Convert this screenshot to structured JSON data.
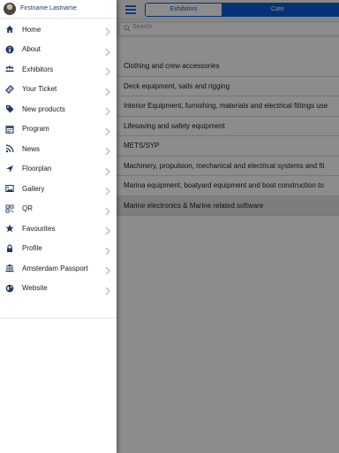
{
  "profile": {
    "name": "Firstname Lastname"
  },
  "tabs": {
    "exhibitors": "Exhibitors",
    "categories": "Cate"
  },
  "search": {
    "placeholder": "Search"
  },
  "menu": [
    {
      "label": "Home",
      "icon": "home-icon"
    },
    {
      "label": "About",
      "icon": "info-icon"
    },
    {
      "label": "Exhibitors",
      "icon": "people-icon"
    },
    {
      "label": "Your Ticket",
      "icon": "ticket-icon"
    },
    {
      "label": "New products",
      "icon": "tag-icon"
    },
    {
      "label": "Program",
      "icon": "calendar-icon"
    },
    {
      "label": "News",
      "icon": "rss-icon"
    },
    {
      "label": "Floorplan",
      "icon": "location-arrow-icon"
    },
    {
      "label": "Gallery",
      "icon": "image-icon"
    },
    {
      "label": "QR",
      "icon": "qr-code-icon"
    },
    {
      "label": "Favourites",
      "icon": "star-icon"
    },
    {
      "label": "Profile",
      "icon": "lock-icon"
    },
    {
      "label": "Amsterdam Passport",
      "icon": "bank-icon"
    },
    {
      "label": "Website",
      "icon": "globe-icon"
    }
  ],
  "categories": [
    "Clothing and crew accessories",
    "Deck equipment, sails and rigging",
    "Interior Equipment, furnishing, materials and electrical fittings use",
    "Lifesaving and safety equipment",
    "METS/SYP",
    "Machinery, propulsion, mechanical and electrical systems and fit",
    "Marina equipment, boatyard equipment and boat construction to",
    "Marine electronics & Marine related software"
  ],
  "colors": {
    "accent": "#0a5fd7",
    "icon": "#1f3a66"
  }
}
